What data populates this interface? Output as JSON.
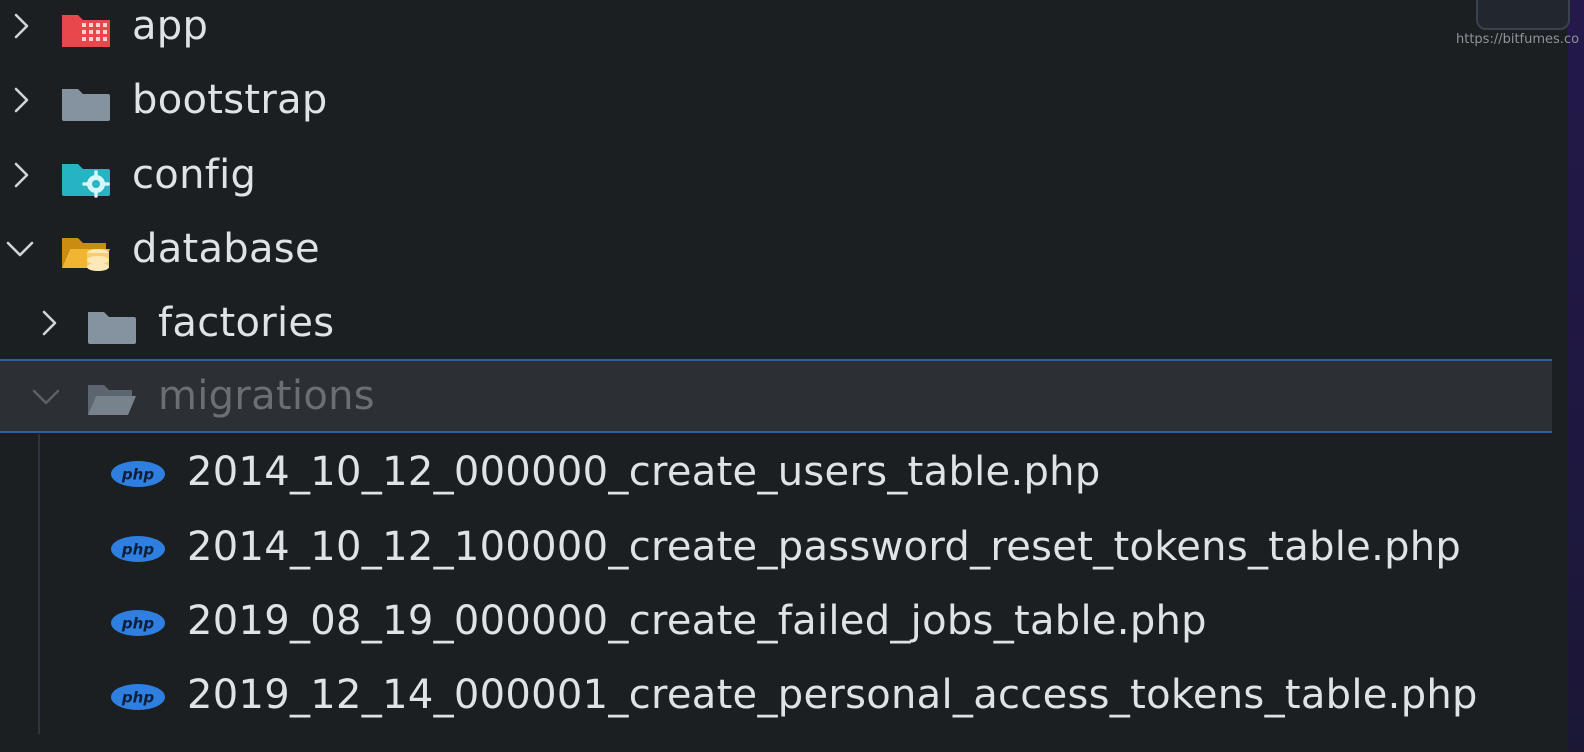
{
  "watermark": {
    "url": "https://bitfumes.co"
  },
  "tree": {
    "items": [
      {
        "label": "app",
        "icon": "app-folder-icon",
        "chevron": "chevron-right-icon",
        "expanded": false
      },
      {
        "label": "bootstrap",
        "icon": "folder-icon",
        "chevron": "chevron-right-icon",
        "expanded": false
      },
      {
        "label": "config",
        "icon": "config-folder-icon",
        "chevron": "chevron-right-icon",
        "expanded": false
      },
      {
        "label": "database",
        "icon": "database-folder-open-icon",
        "chevron": "chevron-down-icon",
        "expanded": true
      },
      {
        "label": "factories",
        "icon": "folder-icon",
        "chevron": "chevron-right-icon",
        "expanded": false
      },
      {
        "label": "migrations",
        "icon": "folder-open-icon",
        "chevron": "chevron-down-icon",
        "expanded": true,
        "selected": true
      }
    ],
    "files": [
      {
        "label": "2014_10_12_000000_create_users_table.php",
        "icon": "php-file-icon"
      },
      {
        "label": "2014_10_12_100000_create_password_reset_tokens_table.php",
        "icon": "php-file-icon"
      },
      {
        "label": "2019_08_19_000000_create_failed_jobs_table.php",
        "icon": "php-file-icon"
      },
      {
        "label": "2019_12_14_000001_create_personal_access_tokens_table.php",
        "icon": "php-file-icon"
      }
    ],
    "php_badge_text": "php"
  },
  "colors": {
    "background": "#1c1f22",
    "text": "#dfe3e8",
    "selection_border": "#2e5f9e",
    "selection_bg": "#2c3035",
    "app_folder": "#e8474b",
    "config_folder": "#26b3c2",
    "database_folder": "#f2b531",
    "plain_folder": "#8593a0",
    "php_badge": "#2f7fe0"
  }
}
